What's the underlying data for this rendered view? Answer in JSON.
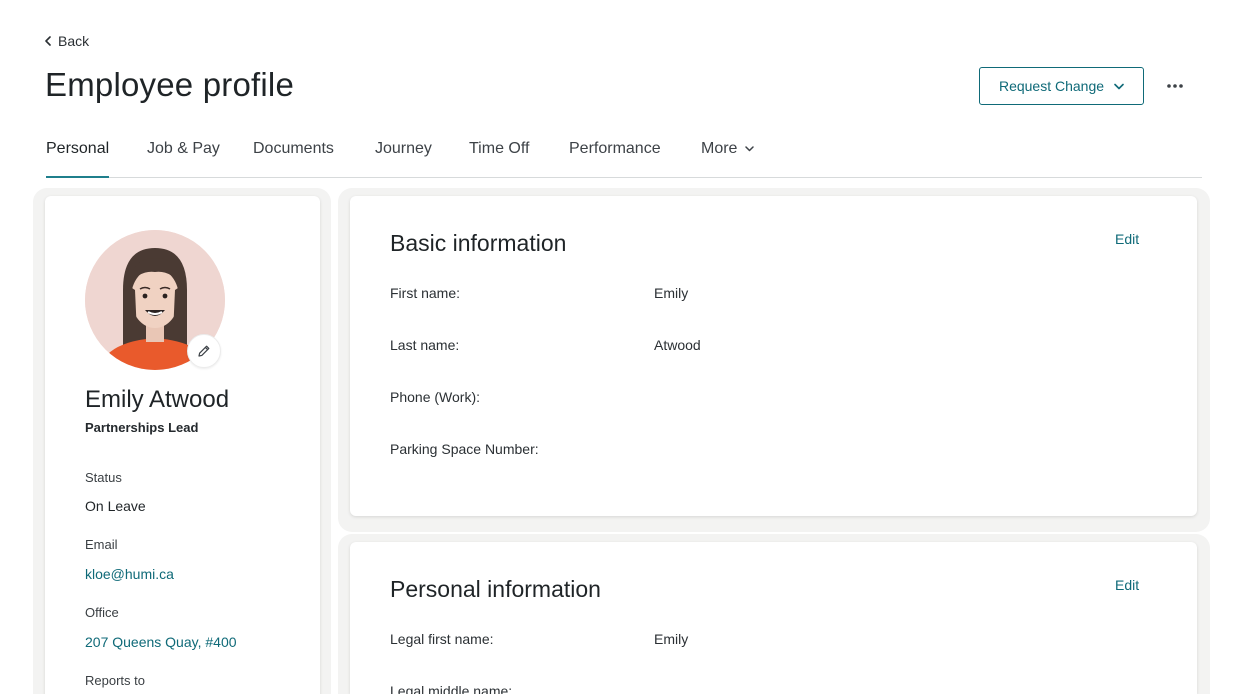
{
  "nav": {
    "back_label": "Back"
  },
  "header": {
    "title": "Employee profile",
    "request_change_label": "Request Change"
  },
  "tabs": [
    {
      "label": "Personal",
      "active": true
    },
    {
      "label": "Job & Pay"
    },
    {
      "label": "Documents"
    },
    {
      "label": "Journey"
    },
    {
      "label": "Time Off"
    },
    {
      "label": "Performance"
    },
    {
      "label": "More"
    }
  ],
  "profile": {
    "name": "Emily Atwood",
    "role": "Partnerships Lead",
    "status_label": "Status",
    "status_value": "On Leave",
    "email_label": "Email",
    "email_value": "kloe@humi.ca",
    "office_label": "Office",
    "office_value": "207 Queens Quay, #400",
    "reports_label": "Reports to"
  },
  "basic_info": {
    "title": "Basic information",
    "edit_label": "Edit",
    "fields": [
      {
        "label": "First name:",
        "value": "Emily"
      },
      {
        "label": "Last name:",
        "value": "Atwood"
      },
      {
        "label": "Phone (Work):",
        "value": ""
      },
      {
        "label": "Parking Space Number:",
        "value": ""
      }
    ]
  },
  "personal_info": {
    "title": "Personal information",
    "edit_label": "Edit",
    "fields": [
      {
        "label": "Legal first name:",
        "value": "Emily"
      },
      {
        "label": "Legal middle name:",
        "value": ""
      }
    ]
  },
  "colors": {
    "accent": "#0f6a78",
    "tab_underline": "#1f7f8c",
    "panel_bg": "#f3f3f2"
  }
}
